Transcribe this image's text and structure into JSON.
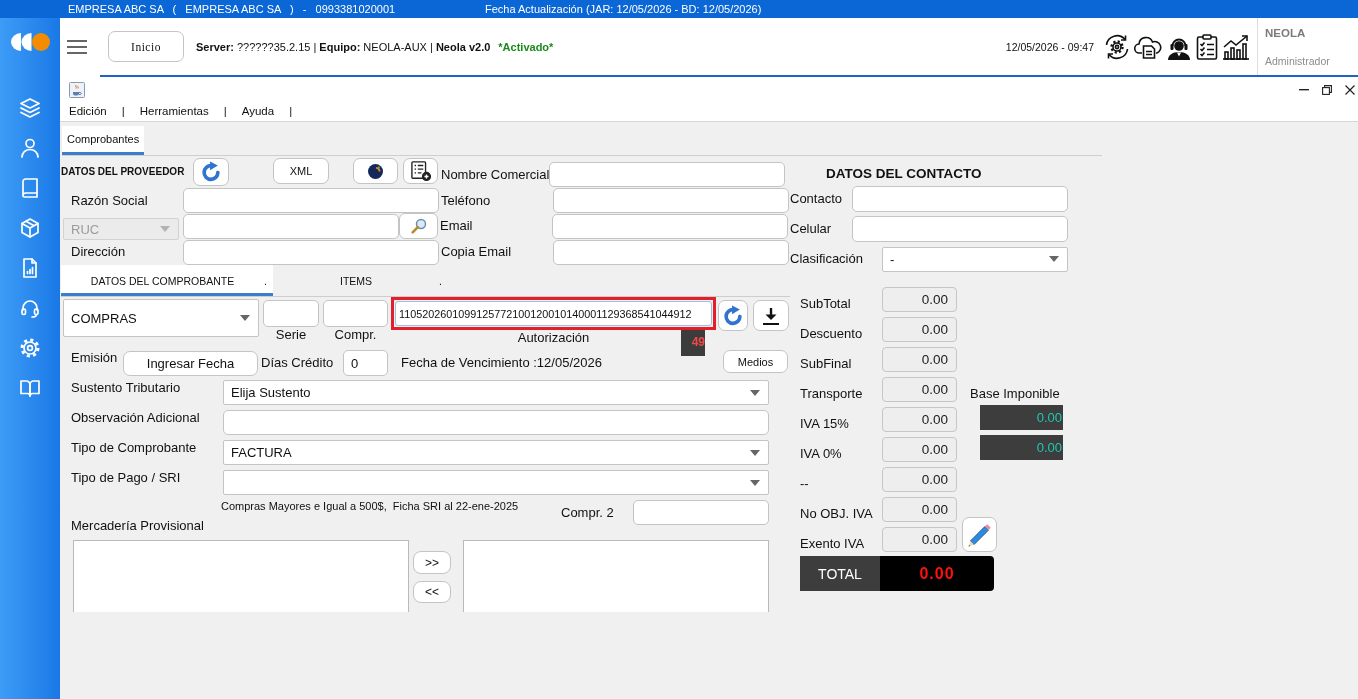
{
  "top_bar": {
    "company": "EMPRESA ABC SA   (   EMPRESA ABC SA   )   -   0993381020001",
    "update_info": "Fecha Actualización (JAR: 12/05/2026 - BD: 12/05/2026)"
  },
  "header": {
    "home_button": "Inicio",
    "server_info": "**Server:** ??????35.2.15 | **Equipo:** NEOLA-AUX | **Neola v2.0**",
    "status": "*Activado*",
    "datetime": "12/05/2026 - 09:47",
    "user": {
      "name": "NEOLA",
      "role": "Administrador"
    }
  },
  "window": {
    "menu": [
      {
        "label": "Edición",
        "separator": "|"
      },
      {
        "label": "Herramientas",
        "separator": "|"
      },
      {
        "label": "Ayuda",
        "separator": "|"
      }
    ],
    "tabs": [
      {
        "label": "Comprobantes",
        "selected": true
      }
    ]
  },
  "provider": {
    "title": "DATOS DEL PROVEEDOR",
    "xml_button": "XML",
    "business_name": {
      "label": "Razón Social"
    },
    "id_type": {
      "value": "RUC",
      "disabled": true
    },
    "address": {
      "label": "Dirección"
    },
    "trade_name": {
      "label": "Nombre Comercial"
    },
    "phone": {
      "label": "Teléfono"
    },
    "email": {
      "label": "Email"
    },
    "copy_email": {
      "label": "Copia Email"
    }
  },
  "contact": {
    "title": "DATOS DEL CONTACTO",
    "contact": {
      "label": "Contacto"
    },
    "mobile": {
      "label": "Celular"
    },
    "classification": {
      "label": "Clasificación",
      "value": "-"
    }
  },
  "voucher": {
    "tabs": [
      {
        "label": "DATOS DEL COMPROBANTE",
        "suffix": ".",
        "selected": true
      },
      {
        "label": "ITEMS",
        "suffix": ".",
        "selected": false
      }
    ],
    "document_type": {
      "value": "COMPRAS"
    },
    "serie": {
      "label": "Serie"
    },
    "number": {
      "label": "Compr."
    },
    "authorization": {
      "label": "Autorización",
      "value": "1105202601099125772100120010140001129368541044912",
      "highlighted": true,
      "length": "49"
    },
    "emission": {
      "label": "Emisión",
      "button": "Ingresar Fecha"
    },
    "credit_days": {
      "label": "Días Crédito",
      "value": "0"
    },
    "due_date": "Fecha de Vencimiento :12/05/2026",
    "media_button": "Medios",
    "rows": [
      {
        "kind": "select",
        "label": "Sustento Tributario",
        "value": "Elija Sustento"
      },
      {
        "kind": "input",
        "label": "Observación Adicional"
      },
      {
        "kind": "select",
        "label": "Tipo de Comprobante",
        "value": "FACTURA"
      },
      {
        "kind": "select",
        "label": "Tipo de Pago / SRI"
      }
    ],
    "note": "Compras Mayores e Igual a 500$,  Ficha SRI al 22-ene-2025",
    "number_2": {
      "label": "Compr. 2"
    },
    "provisional": {
      "label": "Mercadería Provisional",
      "add_button": ">>",
      "remove_button": "<<"
    }
  },
  "totals": {
    "rows": [
      {
        "label": "SubTotal",
        "value": "0.00"
      },
      {
        "label": "Descuento",
        "value": "0.00"
      },
      {
        "label": "SubFinal",
        "value": "0.00"
      },
      {
        "label": "Transporte",
        "value": "0.00"
      },
      {
        "label": "IVA 15%",
        "value": "0.00"
      },
      {
        "label": "IVA 0%",
        "value": "0.00"
      },
      {
        "label": "--",
        "value": "0.00"
      },
      {
        "label": "No OBJ. IVA",
        "value": "0.00"
      },
      {
        "label": "Exento IVA",
        "value": "0.00"
      }
    ],
    "taxable_base": {
      "label": "Base Imponible",
      "values": [
        "0.00",
        "0.00"
      ]
    },
    "total": {
      "label": "TOTAL",
      "value": "0.00"
    }
  }
}
